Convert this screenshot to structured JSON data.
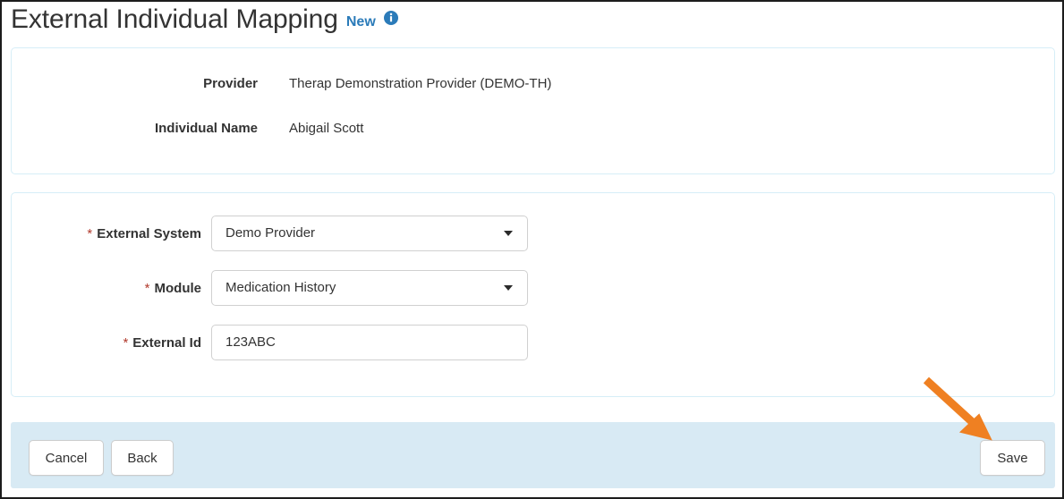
{
  "header": {
    "title": "External Individual Mapping",
    "badge": "New",
    "info_icon": "info-circle-icon"
  },
  "info_panel": {
    "rows": [
      {
        "label": "Provider",
        "value": "Therap Demonstration Provider (DEMO-TH)"
      },
      {
        "label": "Individual Name",
        "value": "Abigail Scott"
      }
    ]
  },
  "form": {
    "required_marker": "*",
    "fields": [
      {
        "label": "External System",
        "type": "select",
        "value": "Demo Provider",
        "required": true,
        "caret_icon": "chevron-down-icon"
      },
      {
        "label": "Module",
        "type": "select",
        "value": "Medication History",
        "required": true,
        "caret_icon": "chevron-down-icon"
      },
      {
        "label": "External Id",
        "type": "text",
        "value": "123ABC",
        "placeholder": "External Id",
        "required": true
      }
    ]
  },
  "footer": {
    "cancel_label": "Cancel",
    "back_label": "Back",
    "save_label": "Save"
  },
  "annotation": {
    "type": "arrow",
    "points_to": "save-button",
    "color": "#ef8022"
  },
  "colors": {
    "panel_border": "#d6eef7",
    "footer_background": "#d8eaf4",
    "badge_blue": "#2b7bb9",
    "required_red": "#b23b2e",
    "arrow_orange": "#ef8022",
    "text": "#333333"
  }
}
